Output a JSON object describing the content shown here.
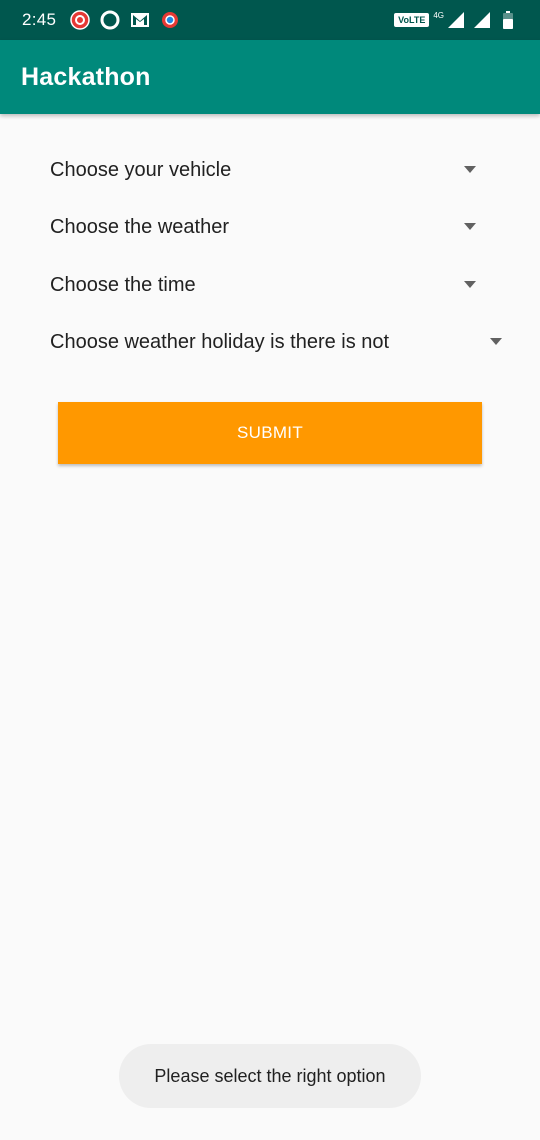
{
  "status_bar": {
    "time": "2:45",
    "volte": "VoLTE",
    "network": "4G",
    "icons": [
      "notification-badge-icon",
      "vodafone-icon",
      "gmail-icon",
      "chrome-icon",
      "signal-icon",
      "signal-icon",
      "battery-icon"
    ]
  },
  "app_bar": {
    "title": "Hackathon"
  },
  "form": {
    "spinners": [
      {
        "label": "Choose your vehicle"
      },
      {
        "label": "Choose the weather"
      },
      {
        "label": "Choose the time"
      },
      {
        "label": "Choose weather holiday is there is not"
      }
    ],
    "submit_label": "SUBMIT"
  },
  "toast": {
    "message": "Please select the right option"
  },
  "colors": {
    "status_bar": "#00574e",
    "primary": "#00897b",
    "accent": "#ff9800",
    "background": "#fafafa",
    "toast_bg": "#eeeeee"
  }
}
